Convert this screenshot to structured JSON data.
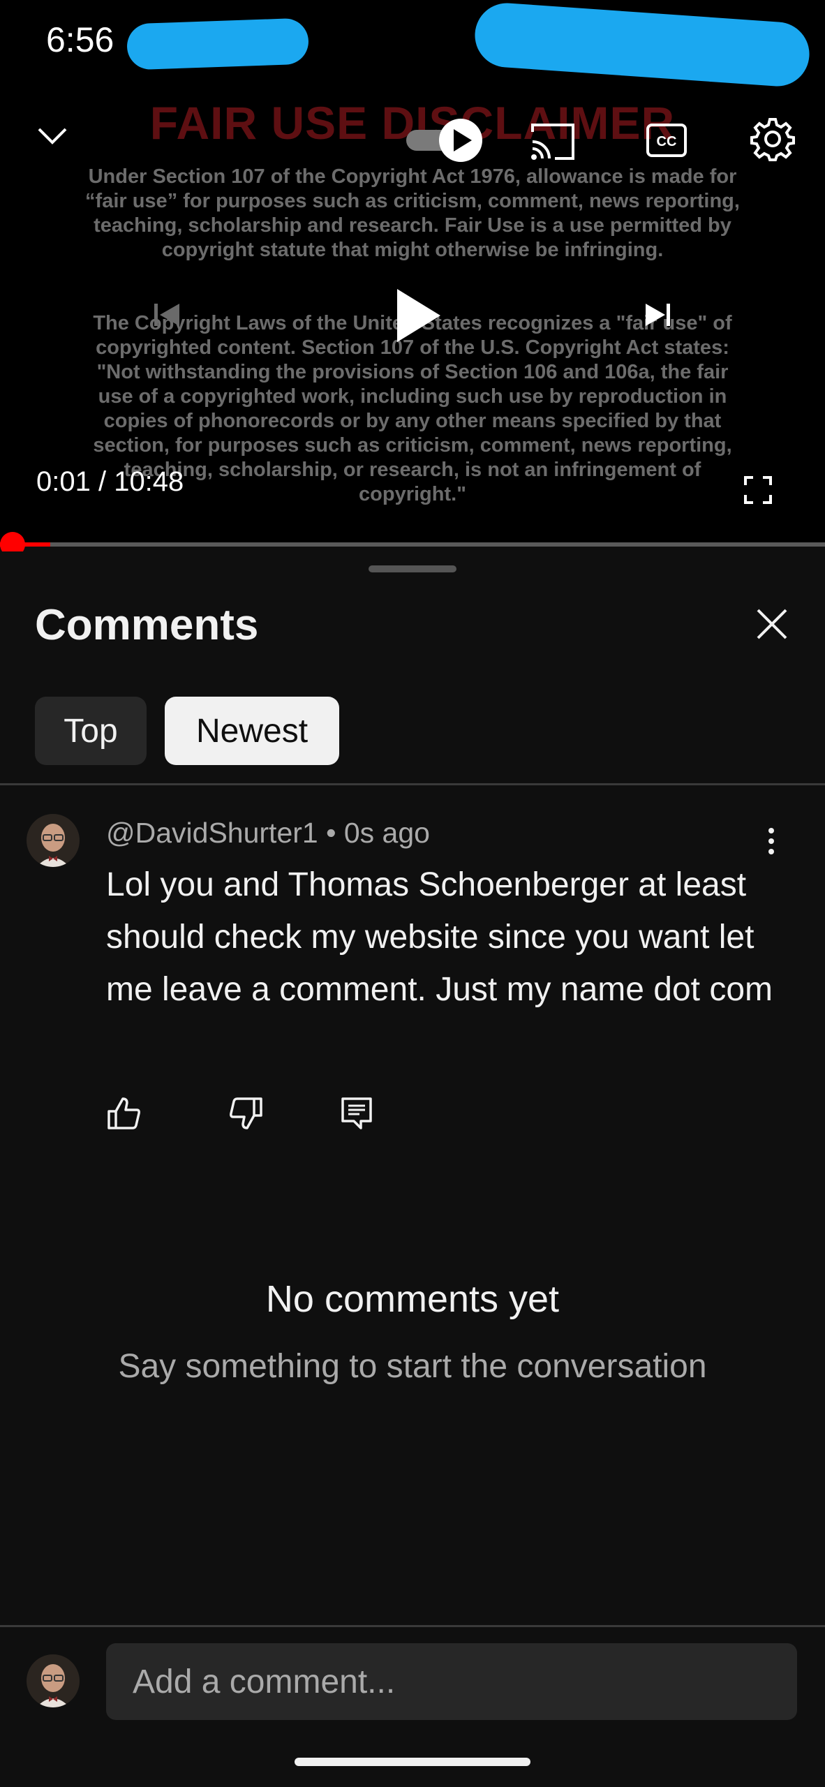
{
  "status_bar": {
    "time": "6:56"
  },
  "player": {
    "timecode": "0:01 / 10:48",
    "progress_fraction": 0.0016,
    "disclaimer": {
      "title": "FAIR USE DISCLAIMER",
      "paragraph1": "Under Section 107 of the Copyright Act 1976, allowance is made for “fair use” for purposes such as criticism, comment, news reporting, teaching, scholarship and research. Fair Use is a use permitted by copyright statute that might otherwise be infringing.",
      "paragraph2": "The Copyright Laws of the United States recognizes a \"fair use\" of copyrighted content. Section 107 of the U.S. Copyright Act states: \"Not withstanding the provisions of Section 106 and 106a, the fair use of a copyrighted work, including such use by reproduction in copies of phonorecords or by any other means specified by that section, for purposes such as criticism, comment, news reporting, teaching, scholarship, or research, is not an infringement of copyright.\""
    },
    "icons": [
      "chevron-down-icon",
      "autoplay-toggle-icon",
      "cast-icon",
      "captions-icon",
      "settings-gear-icon",
      "previous-icon",
      "play-icon",
      "next-icon",
      "fullscreen-icon"
    ]
  },
  "comments_panel": {
    "title": "Comments",
    "tabs": [
      {
        "label": "Top",
        "selected": false
      },
      {
        "label": "Newest",
        "selected": true
      }
    ],
    "comment": {
      "author": "@DavidShurter1",
      "separator": " • ",
      "age": "0s ago",
      "text": "Lol you and Thomas Schoenberger at least should check my website since you want let me leave a comment. Just my name dot com"
    },
    "empty_state": {
      "title": "No comments yet",
      "subtitle": "Say something to start the conversation"
    },
    "composer": {
      "placeholder": "Add a comment..."
    }
  },
  "colors": {
    "background": "#0f0f0f",
    "accent_red": "#ff0000",
    "chip_selected": "#f1f1f1",
    "chip_default": "#272727"
  }
}
